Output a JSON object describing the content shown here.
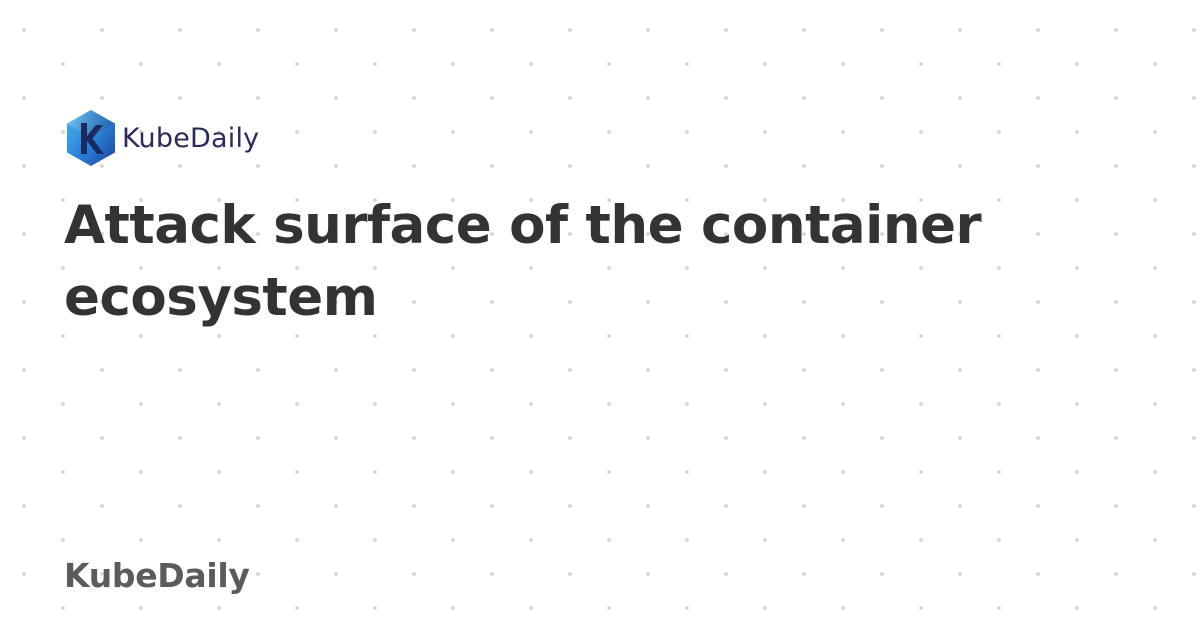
{
  "brand": {
    "logo_text": "KubeDaily",
    "logo_icon": "kubedaily-hexagon-logo",
    "colors": {
      "logo_blue_light": "#3aa8e8",
      "logo_blue_dark": "#1c3f9c",
      "logo_text": "#2a2a5e"
    }
  },
  "article": {
    "title": "Attack surface of the container ecosystem"
  },
  "footer": {
    "site_name": "KubeDaily"
  },
  "colors": {
    "background": "#ffffff",
    "title": "#333333",
    "footer_text": "#5b5b5b",
    "pattern_dot": "#d4d4d8"
  }
}
